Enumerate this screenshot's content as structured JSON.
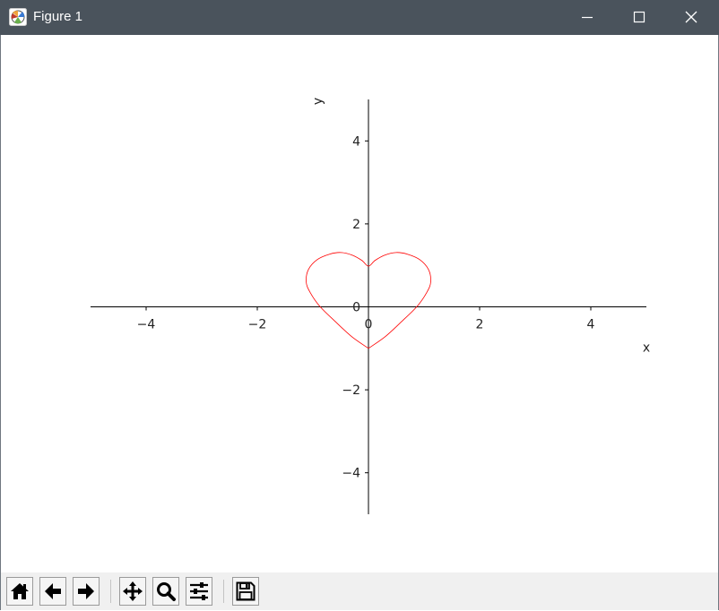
{
  "window": {
    "title": "Figure 1",
    "controls": [
      "minimize",
      "maximize",
      "close"
    ]
  },
  "toolbar": {
    "buttons": [
      {
        "name": "home",
        "icon": "home-icon"
      },
      {
        "name": "back",
        "icon": "arrow-left-icon"
      },
      {
        "name": "forward",
        "icon": "arrow-right-icon"
      },
      {
        "name": "pan",
        "icon": "move-icon"
      },
      {
        "name": "zoom",
        "icon": "magnifier-icon"
      },
      {
        "name": "configure-subplots",
        "icon": "sliders-icon"
      },
      {
        "name": "save",
        "icon": "floppy-disk-icon"
      }
    ]
  },
  "chart_data": {
    "type": "line",
    "title": "",
    "xlabel": "x",
    "ylabel": "y",
    "xlim": [
      -5,
      5
    ],
    "ylim": [
      -5,
      5
    ],
    "xticks": [
      -4,
      -2,
      0,
      2,
      4
    ],
    "yticks": [
      -4,
      -2,
      0,
      2,
      4
    ],
    "xtick_labels": [
      "−4",
      "−2",
      "0",
      "2",
      "4"
    ],
    "ytick_labels": [
      "−4",
      "−2",
      "0",
      "2",
      "4"
    ],
    "spines": "centered",
    "grid": false,
    "series": [
      {
        "color": "#ff0000",
        "points": [
          [
            0.0,
            -1.0
          ],
          [
            0.3,
            -0.72
          ],
          [
            0.6,
            -0.35
          ],
          [
            0.88,
            0.02
          ],
          [
            1.05,
            0.35
          ],
          [
            1.12,
            0.6
          ],
          [
            1.08,
            0.9
          ],
          [
            0.92,
            1.14
          ],
          [
            0.7,
            1.27
          ],
          [
            0.5,
            1.31
          ],
          [
            0.3,
            1.25
          ],
          [
            0.12,
            1.12
          ],
          [
            0.0,
            0.98
          ],
          [
            -0.12,
            1.12
          ],
          [
            -0.3,
            1.25
          ],
          [
            -0.5,
            1.31
          ],
          [
            -0.7,
            1.27
          ],
          [
            -0.92,
            1.14
          ],
          [
            -1.08,
            0.9
          ],
          [
            -1.12,
            0.6
          ],
          [
            -1.05,
            0.35
          ],
          [
            -0.88,
            0.02
          ],
          [
            -0.6,
            -0.35
          ],
          [
            -0.3,
            -0.72
          ],
          [
            0.0,
            -1.0
          ]
        ]
      }
    ]
  }
}
